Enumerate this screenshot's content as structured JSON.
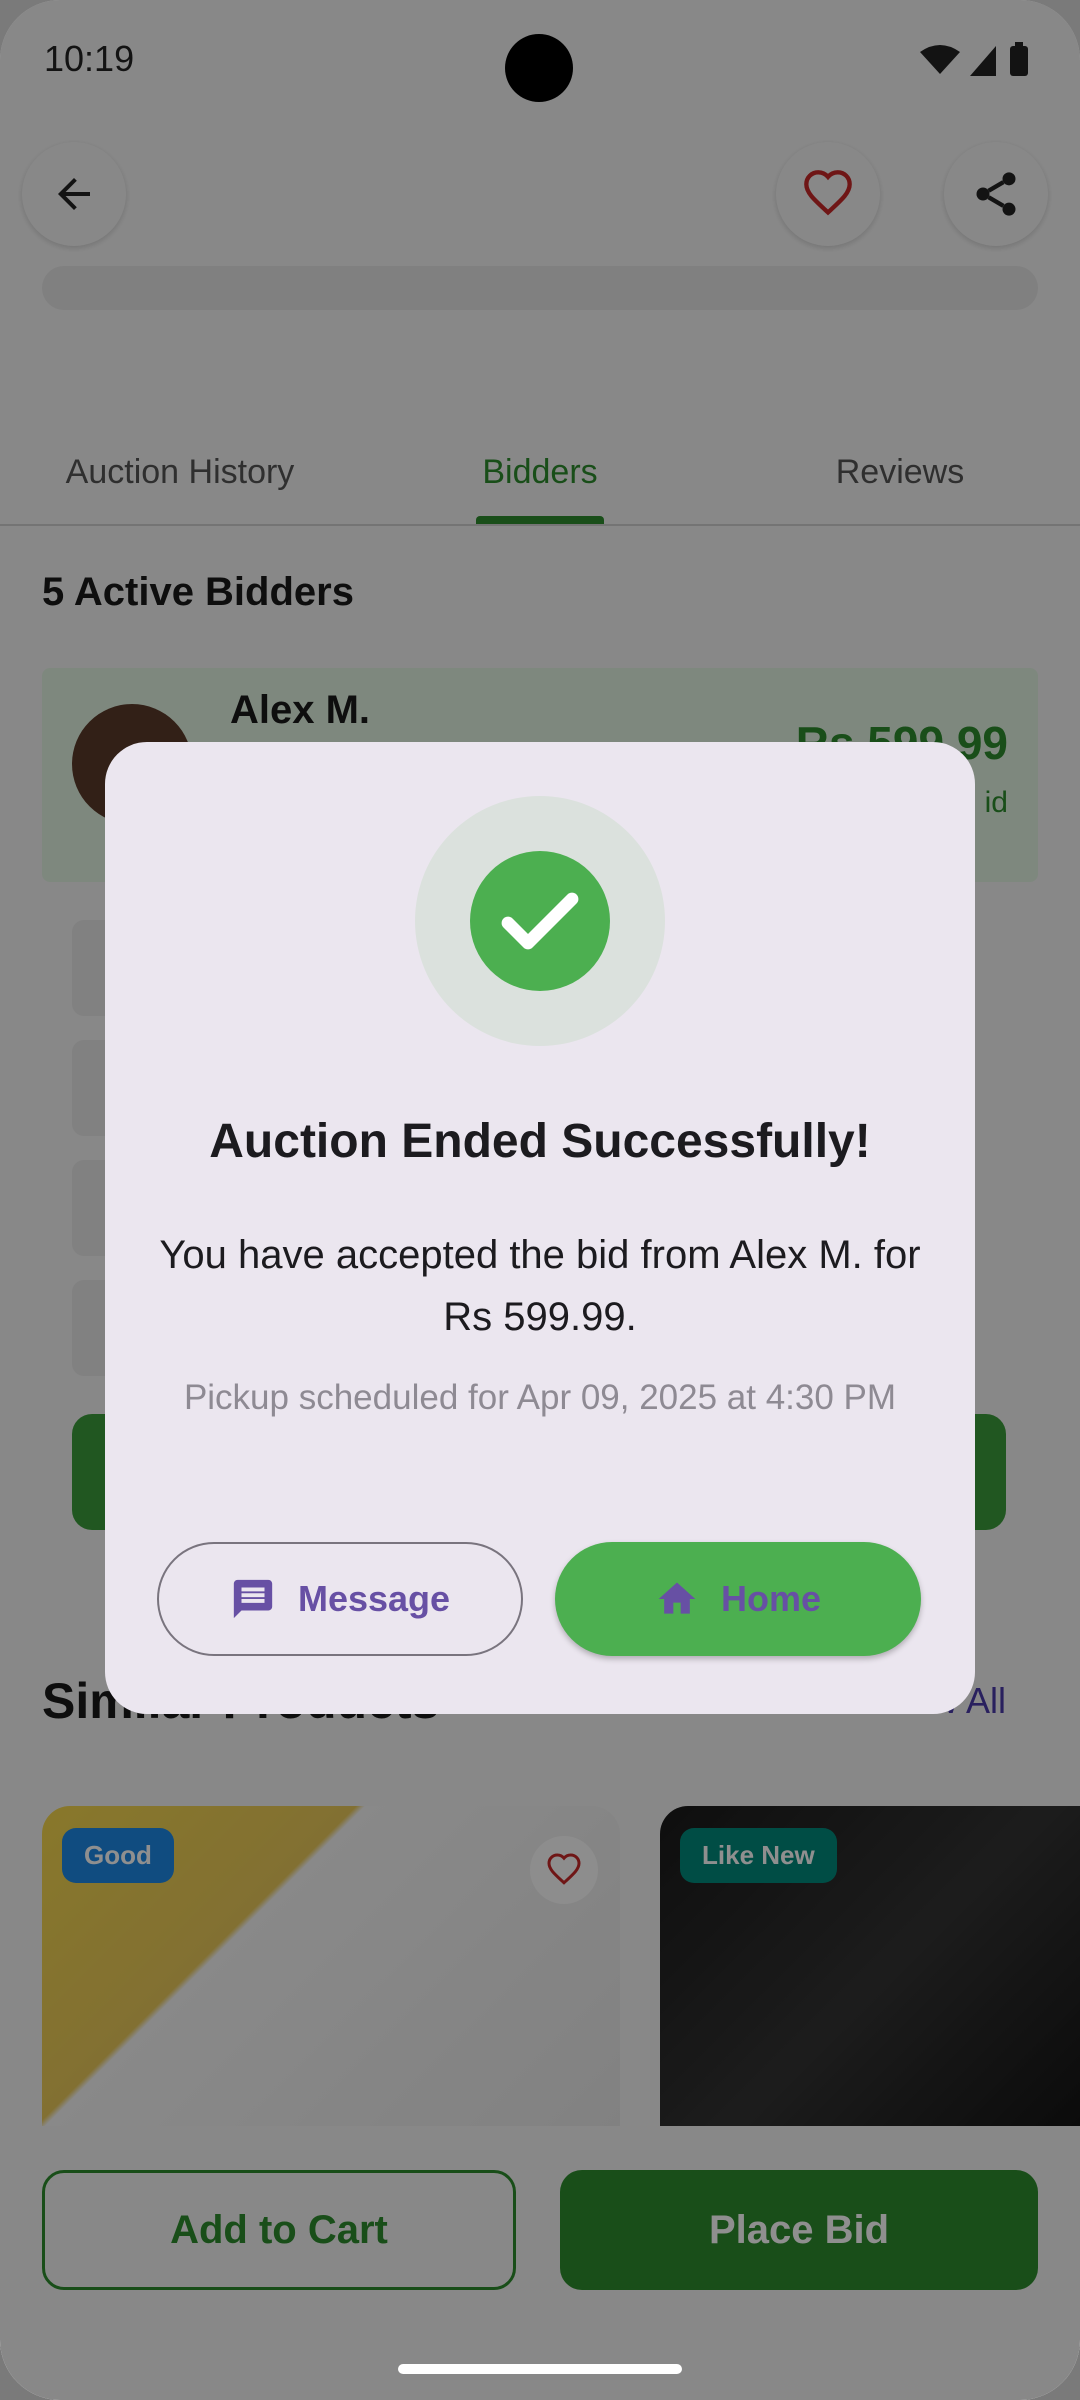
{
  "status_bar": {
    "time": "10:19"
  },
  "tabs": [
    {
      "label": "Auction History"
    },
    {
      "label": "Bidders"
    },
    {
      "label": "Reviews"
    }
  ],
  "bidders": {
    "title": "5 Active Bidders",
    "top_bidder": {
      "name": "Alex M.",
      "amount": "Rs 599.99",
      "sub": "id"
    }
  },
  "similar": {
    "title": "Similar Products",
    "view_all": "View All",
    "products": [
      {
        "badge": "Good",
        "badge_color": "#1e88e5"
      },
      {
        "badge": "Like New",
        "badge_color": "#00897b"
      }
    ]
  },
  "actions": {
    "add_to_cart": "Add to Cart",
    "place_bid": "Place Bid"
  },
  "dialog": {
    "title": "Auction Ended Successfully!",
    "body": "You have accepted the bid from Alex M. for Rs 599.99.",
    "note": "Pickup scheduled for Apr 09, 2025 at 4:30 PM",
    "message_label": "Message",
    "home_label": "Home"
  },
  "colors": {
    "accent_green": "#2e8b2e",
    "success_green": "#4caf50",
    "dialog_purple": "#6750a4",
    "heart_red": "#c62828"
  },
  "icons": [
    "back-arrow-icon",
    "heart-icon",
    "share-icon",
    "check-icon",
    "message-icon",
    "home-icon"
  ]
}
